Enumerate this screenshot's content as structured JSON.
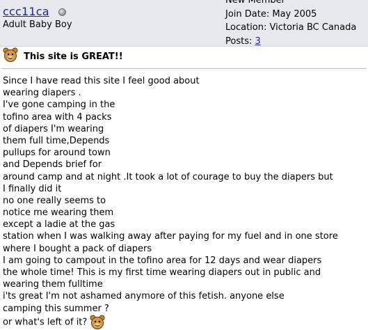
{
  "user": {
    "username": "ccc11ca",
    "title": "Adult Baby Boy",
    "rank": "New Member",
    "join_date": "Join Date: May 2005",
    "location": "Location: Victoria BC Canada",
    "posts_label": "Posts: ",
    "posts_count": "3"
  },
  "post": {
    "title_icon": "teddy-bear-smiley-icon",
    "title": "This site is GREAT!!",
    "lines": [
      "Since I have read this site I feel good about",
      "wearing diapers .",
      "I've gone camping in the",
      "tofino area with 4 packs",
      "of diapers I'm wearing",
      "them full time,Depends",
      "pullups for around town",
      "and Depends brief for",
      "around camp and at night .It took a lot of courage to buy the diapers but",
      "I finally did it",
      "no one really seems to",
      "notice me wearing them",
      "except a ladie at the gas",
      "station when I was walking away after paying for my fuel and in one store",
      "where I bought a pack of diapers",
      "I am going to campout in the tofino area for 12 days and wear diapers",
      "the whole time! This is my first time wearing diapers out in public and",
      "wearing them fulltime",
      "i'ts great I'm not ashamed anymore of this fetish. anyone else",
      "camping this summer ?",
      "or what's left of it?"
    ],
    "end_icon": "teddy-bear-smiley-icon"
  },
  "colors": {
    "header_bg": "#e8e8ef",
    "link": "#22229c"
  }
}
